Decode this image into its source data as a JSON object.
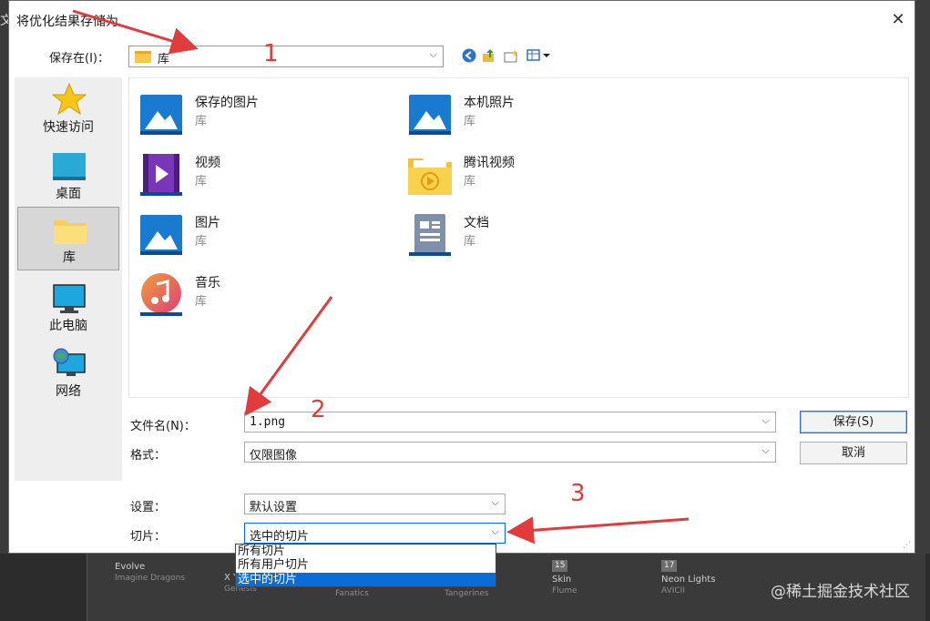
{
  "dialog": {
    "title": "将优化结果存储为",
    "close_glyph": "✕",
    "save_in_label": "保存在(I)：",
    "save_in_value": "库"
  },
  "places": [
    {
      "label": "快速访问",
      "icon": "star-icon"
    },
    {
      "label": "桌面",
      "icon": "desktop-icon"
    },
    {
      "label": "库",
      "icon": "library-folder-icon"
    },
    {
      "label": "此电脑",
      "icon": "computer-icon"
    },
    {
      "label": "网络",
      "icon": "network-icon"
    }
  ],
  "files": [
    {
      "name": "保存的图片",
      "type": "库",
      "icon": "pictures-library-icon"
    },
    {
      "name": "本机照片",
      "type": "库",
      "icon": "pictures-library-icon"
    },
    {
      "name": "视频",
      "type": "库",
      "icon": "videos-library-icon"
    },
    {
      "name": "腾讯视频",
      "type": "库",
      "icon": "tencent-video-folder-icon"
    },
    {
      "name": "图片",
      "type": "库",
      "icon": "pictures-library-icon"
    },
    {
      "name": "文档",
      "type": "库",
      "icon": "documents-library-icon"
    },
    {
      "name": "音乐",
      "type": "库",
      "icon": "music-library-icon"
    }
  ],
  "form": {
    "filename_label": "文件名(N)：",
    "filename_value": "1.png",
    "format_label": "格式：",
    "format_value": "仅限图像",
    "settings_label": "设置：",
    "settings_value": "默认设置",
    "slices_label": "切片：",
    "slices_value": "选中的切片",
    "slices_options": [
      "所有切片",
      "所有用户切片",
      "选中的切片"
    ],
    "save_button": "保存(S)",
    "cancel_button": "取消"
  },
  "annotations": {
    "one": "1",
    "two": "2",
    "three": "3"
  },
  "background": {
    "left_glyph": "文",
    "tiles": [
      {
        "num": "",
        "title": "Evolve",
        "artist": "Imagine Dragons"
      },
      {
        "num": "",
        "title": "X Y K",
        "artist": "Genesis"
      },
      {
        "num": "",
        "title": "",
        "artist": "Fanatics"
      },
      {
        "num": "",
        "title": "",
        "artist": "Tangerines"
      },
      {
        "num": "15",
        "title": "Skin",
        "artist": "Flume"
      },
      {
        "num": "17",
        "title": "Neon Lights",
        "artist": "AVICII"
      }
    ],
    "watermark": "@稀土掘金技术社区"
  },
  "colors": {
    "accent": "#0a6cd8",
    "annotation": "#e23b3b"
  }
}
